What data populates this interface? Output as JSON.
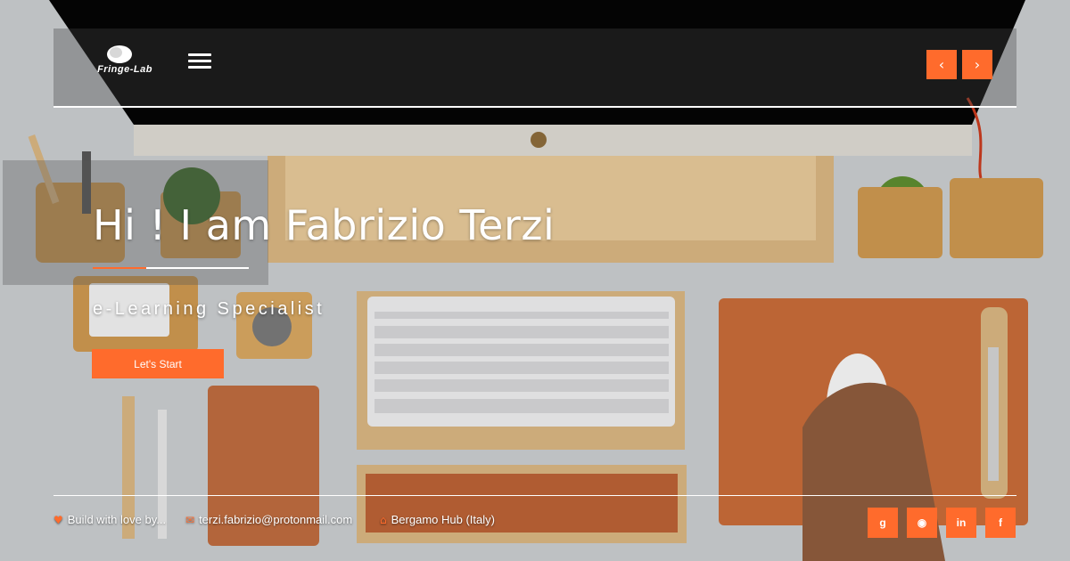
{
  "brand": {
    "logo_text": "Fringe-Lab"
  },
  "nav": {
    "prev_icon": "chevron-left-icon",
    "next_icon": "chevron-right-icon",
    "prev_glyph": "‹",
    "next_glyph": "›",
    "menu_icon": "hamburger-menu-icon"
  },
  "hero": {
    "title": "Hi ! I am Fabrizio Terzi",
    "subtitle": "e-Learning Specialist",
    "cta_label": "Let's Start"
  },
  "footer": {
    "items": [
      {
        "icon": "heart-icon",
        "glyph": "♥",
        "text": "Build with love by..."
      },
      {
        "icon": "mail-icon",
        "glyph": "✉",
        "text": "terzi.fabrizio@protonmail.com"
      },
      {
        "icon": "home-icon",
        "glyph": "⌂",
        "text": "Bergamo Hub (Italy)"
      }
    ],
    "social": [
      {
        "icon": "google-plus-icon",
        "glyph": "g"
      },
      {
        "icon": "github-icon",
        "glyph": "◉"
      },
      {
        "icon": "linkedin-icon",
        "glyph": "in"
      },
      {
        "icon": "facebook-icon",
        "glyph": "f"
      }
    ]
  },
  "colors": {
    "accent": "#ff6b2c",
    "text": "#ffffff"
  }
}
